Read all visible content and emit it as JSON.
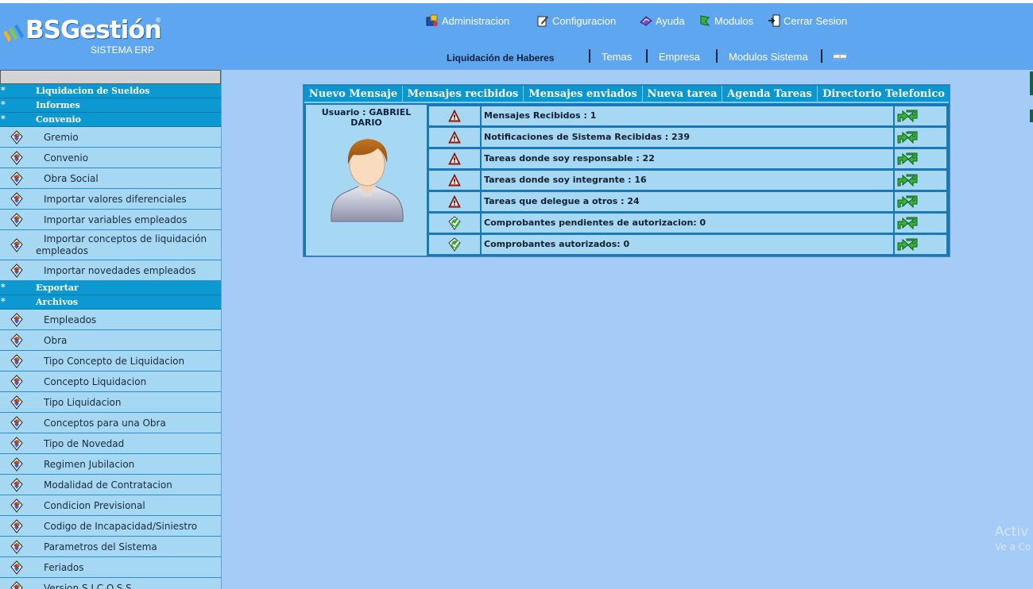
{
  "header": {
    "brand": "BSGestión",
    "registered": "®",
    "brand_sub": "SISTEMA ERP",
    "nav": [
      {
        "label": "Administracion",
        "icon": "admin-icon"
      },
      {
        "label": "Configuracion",
        "icon": "config-icon"
      },
      {
        "label": "Ayuda",
        "icon": "help-icon"
      },
      {
        "label": "Modulos",
        "icon": "modules-icon"
      },
      {
        "label": "Cerrar Sesion",
        "icon": "logout-icon"
      }
    ],
    "module_title": "Liquidación de Haberes",
    "links": [
      "Temas",
      "Empresa",
      "Modulos Sistema"
    ],
    "flag_icon": "argentina-flag-icon"
  },
  "sidebar": {
    "sections": [
      {
        "star": "*",
        "label": "Liquidacion de Sueldos",
        "items": []
      },
      {
        "star": "*",
        "label": "Informes",
        "items": []
      },
      {
        "star": "*",
        "label": "Convenio",
        "items": [
          "Gremio",
          "Convenio",
          "Obra Social",
          "Importar valores diferenciales",
          "Importar variables empleados",
          "Importar conceptos de liquidación empleados",
          "Importar novedades empleados"
        ]
      },
      {
        "star": "*",
        "label": "Exportar",
        "items": []
      },
      {
        "star": "*",
        "label": "Archivos",
        "items": [
          "Empleados",
          "Obra",
          "Tipo Concepto de Liquidacion",
          "Concepto Liquidacion",
          "Tipo Liquidacion",
          "Conceptos para una Obra",
          "Tipo de Novedad",
          "Regimen Jubilacion",
          "Modalidad de Contratacion",
          "Condicion Previsional",
          "Codigo de Incapacidad/Siniestro",
          "Parametros del Sistema",
          "Feriados",
          "Version S.I.C.O.S.S."
        ]
      }
    ]
  },
  "panel": {
    "tabs": [
      "Nuevo Mensaje",
      "Mensajes recibidos",
      "Mensajes enviados",
      "Nueva tarea",
      "Agenda Tareas",
      "Directorio Telefonico"
    ],
    "user_label": "Usuario : GABRIEL DARIO",
    "rows": [
      {
        "status": "warning",
        "text": "Mensajes Recibidos : 1"
      },
      {
        "status": "warning",
        "text": "Notificaciones de Sistema Recibidas : 239"
      },
      {
        "status": "warning",
        "text": "Tareas donde soy responsable : 22"
      },
      {
        "status": "warning",
        "text": "Tareas donde soy integrante : 16"
      },
      {
        "status": "warning",
        "text": "Tareas que delegue a otros : 24"
      },
      {
        "status": "ok",
        "text": "Comprobantes pendientes de autorizacion: 0"
      },
      {
        "status": "ok",
        "text": "Comprobantes autorizados: 0"
      }
    ]
  },
  "watermark": {
    "line1": "Activ",
    "line2": "Ve a Co"
  },
  "colors": {
    "header_bg": "#5fa6f0",
    "page_bg": "#a4ccf6",
    "section_bg": "#0c98d0",
    "item_bg": "#a6d8f4",
    "warning_red": "#d42a1c",
    "ok_green": "#3cab2c"
  }
}
